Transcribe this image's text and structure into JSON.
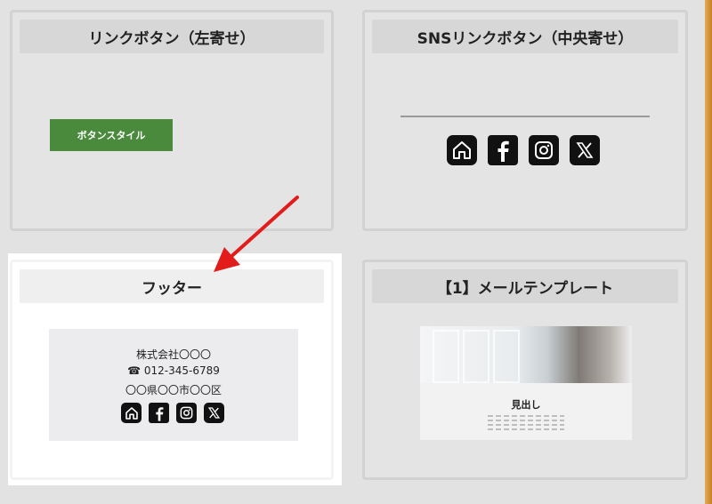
{
  "cards": {
    "link_button_left": {
      "title": "リンクボタン（左寄せ）",
      "button_label": "ボタンスタイル"
    },
    "sns_link_center": {
      "title": "SNSリンクボタン（中央寄せ）",
      "icons": [
        "home-icon",
        "facebook-icon",
        "instagram-icon",
        "x-icon"
      ]
    },
    "footer": {
      "title": "フッター",
      "company": "株式会社〇〇〇",
      "phone": "☎ 012-345-6789",
      "address": "〇〇県〇〇市〇〇区",
      "icons": [
        "home-icon",
        "facebook-icon",
        "instagram-icon",
        "x-icon"
      ]
    },
    "mail_template": {
      "title": "【1】メールテンプレート",
      "preview_heading": "見出し"
    }
  },
  "colors": {
    "background": "#e2e2e2",
    "card_header": "#d7d7d7",
    "button_green": "#4a8a3c",
    "arrow_red": "#e21b1b",
    "edge_orange": "#c97f21"
  }
}
